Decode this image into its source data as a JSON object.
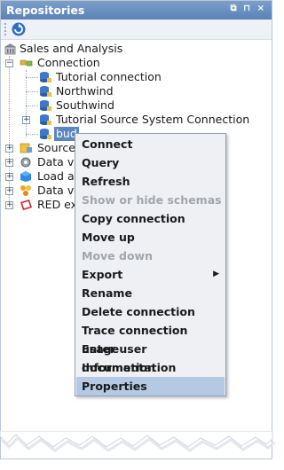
{
  "panel": {
    "title": "Repositories",
    "window_buttons": [
      "⧉",
      "⊓",
      "×"
    ]
  },
  "tree": {
    "root_label": "Sales and Analysis",
    "connection_folder": "Connection",
    "connections": [
      "Tutorial connection",
      "Northwind",
      "Southwind",
      "Tutorial Source System Connection"
    ],
    "selected_partial": "bud",
    "other_nodes": [
      "Source",
      "Data va",
      "Load ar",
      "Data va",
      "RED ex"
    ]
  },
  "context_menu": {
    "items": [
      {
        "label": "Connect",
        "disabled": false
      },
      {
        "label": "Query",
        "disabled": false
      },
      {
        "label": "Refresh",
        "disabled": false
      },
      {
        "label": "Show or hide schemas",
        "disabled": true
      },
      {
        "label": "Copy connection",
        "disabled": false
      },
      {
        "label": "Move up",
        "disabled": false
      },
      {
        "label": "Move down",
        "disabled": true
      },
      {
        "label": "Export",
        "disabled": false,
        "submenu": true
      },
      {
        "label": "Rename",
        "disabled": false
      },
      {
        "label": "Delete connection",
        "disabled": false
      },
      {
        "label": "Trace connection usage",
        "disabled": false
      },
      {
        "label": "Enter user documentation",
        "disabled": false
      },
      {
        "label": "Information",
        "disabled": false
      },
      {
        "label": "Properties",
        "disabled": false,
        "highlighted": true
      }
    ]
  },
  "colors": {
    "titlebar": "#6a8fc0",
    "menu_highlight": "#b4c9e4",
    "disabled_text": "#a2a6ab"
  }
}
